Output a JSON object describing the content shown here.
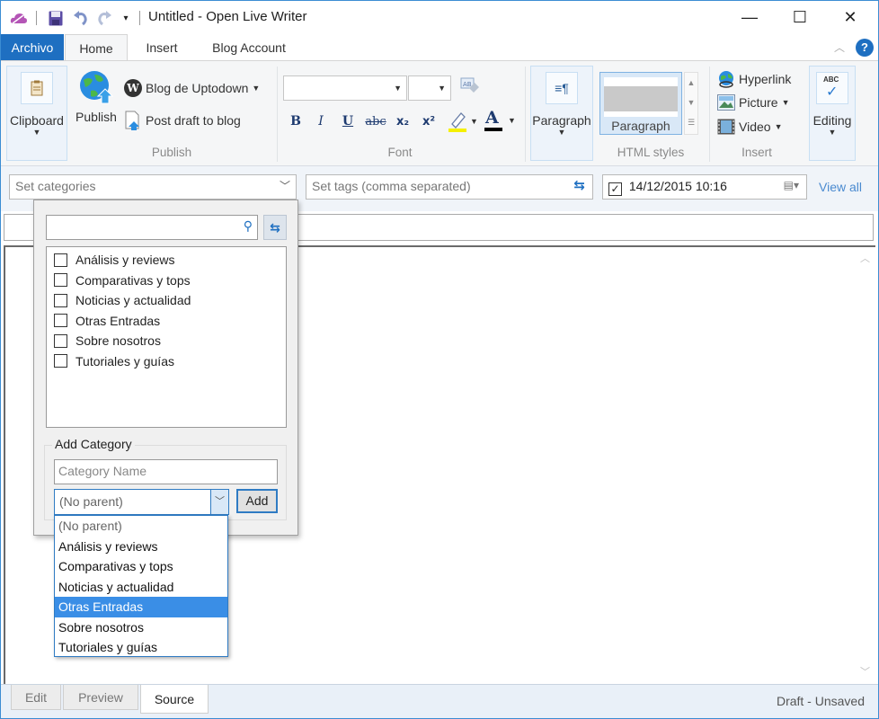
{
  "window": {
    "title": "Untitled - Open Live Writer",
    "controls": {
      "minimize": "—",
      "maximize": "☐",
      "close": "✕"
    }
  },
  "quick_access": {
    "icons": [
      "cloud-icon",
      "save-icon",
      "undo-icon",
      "redo-icon",
      "customize-icon"
    ]
  },
  "tabs": [
    {
      "label": "Archivo",
      "type": "file"
    },
    {
      "label": "Home",
      "active": true
    },
    {
      "label": "Insert"
    },
    {
      "label": "Blog Account"
    }
  ],
  "ribbon": {
    "clipboard": {
      "label": "Clipboard"
    },
    "publish": {
      "publish_label": "Publish",
      "blog_label": "Blog de Uptodown",
      "post_draft_label": "Post draft to blog",
      "group_label": "Publish"
    },
    "font": {
      "font_name": "",
      "font_size": "",
      "group_label": "Font",
      "buttons": {
        "bold": "B",
        "italic": "I",
        "underline": "U",
        "strike": "abc",
        "subscript": "x₂",
        "superscript": "x²"
      },
      "highlight_color": "#f5f000",
      "font_color": "#000000"
    },
    "paragraph": {
      "label": "Paragraph"
    },
    "html_styles": {
      "style_label": "Paragraph",
      "group_label": "HTML styles"
    },
    "insert": {
      "hyperlink": "Hyperlink",
      "picture": "Picture",
      "video": "Video",
      "group_label": "Insert"
    },
    "editing": {
      "label": "Editing"
    }
  },
  "props": {
    "categories_placeholder": "Set categories",
    "tags_placeholder": "Set tags (comma separated)",
    "date_checked": true,
    "date_value": "14/12/2015 10:16",
    "view_all": "View all"
  },
  "category_popup": {
    "search_value": "",
    "categories": [
      {
        "label": "Análisis y reviews",
        "checked": false
      },
      {
        "label": "Comparativas y tops",
        "checked": false
      },
      {
        "label": "Noticias y actualidad",
        "checked": false
      },
      {
        "label": "Otras Entradas",
        "checked": false
      },
      {
        "label": "Sobre nosotros",
        "checked": false
      },
      {
        "label": "Tutoriales y guías",
        "checked": false
      }
    ],
    "add_category": {
      "heading": "Add Category",
      "name_placeholder": "Category Name",
      "parent_selected": "(No parent)",
      "add_label": "Add"
    },
    "parent_options": [
      {
        "label": "(No parent)",
        "muted": true
      },
      {
        "label": "Análisis y reviews"
      },
      {
        "label": "Comparativas y tops"
      },
      {
        "label": "Noticias y actualidad"
      },
      {
        "label": "Otras Entradas",
        "highlighted": true
      },
      {
        "label": "Sobre nosotros"
      },
      {
        "label": "Tutoriales y guías"
      }
    ]
  },
  "bottom": {
    "tabs": [
      {
        "label": "Edit"
      },
      {
        "label": "Preview"
      },
      {
        "label": "Source",
        "active": true
      }
    ],
    "status": "Draft - Unsaved"
  },
  "colors": {
    "accent": "#1e6fc1",
    "selection": "#3a8ee6",
    "link": "#4a8ad0"
  }
}
